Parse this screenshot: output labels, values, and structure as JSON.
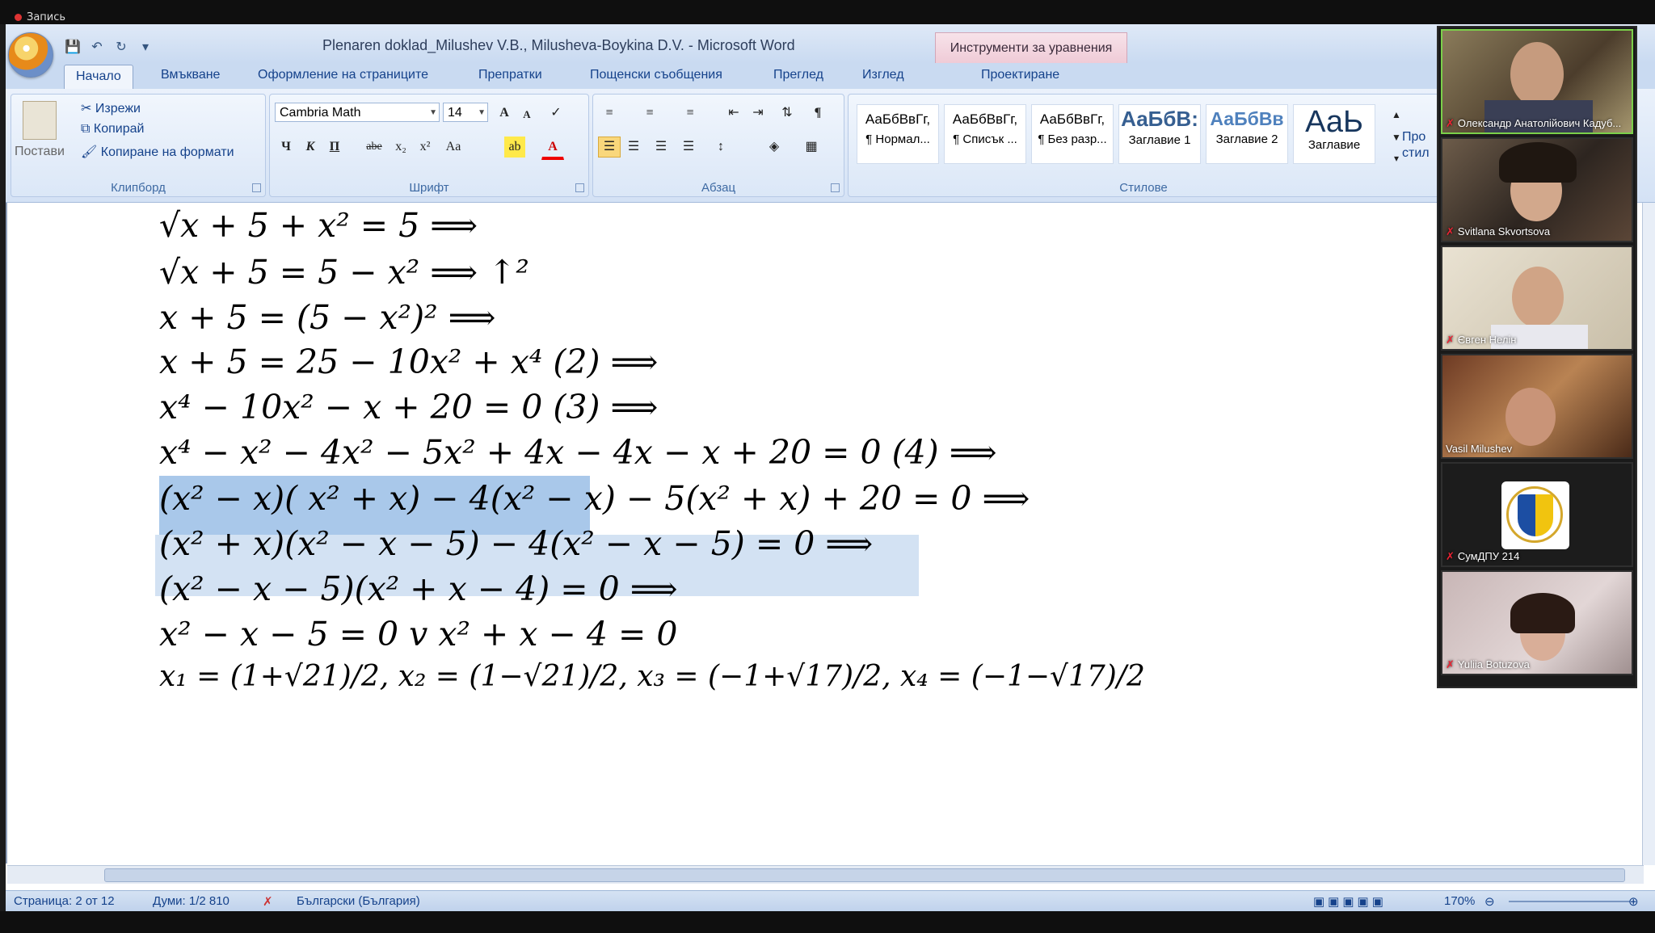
{
  "recording": {
    "label": "Запись"
  },
  "window": {
    "title": "Plenaren doklad_Milushev V.B., Milusheva-Boykina D.V. - Microsoft Word",
    "context_tool": "Инструменти за уравнения"
  },
  "tabs": [
    "Начало",
    "Вмъкване",
    "Оформление на страниците",
    "Препратки",
    "Пощенски съобщения",
    "Преглед",
    "Изглед",
    "Проектиране"
  ],
  "clipboard": {
    "paste": "Постави",
    "cut": "Изрежи",
    "copy": "Копирай",
    "format_painter": "Копиране на формати",
    "label": "Клипборд"
  },
  "font": {
    "name": "Cambria Math",
    "size": "14",
    "label": "Шрифт",
    "bold": "Ч",
    "italic": "К",
    "underline": "П",
    "strike": "abe",
    "sub": "x₂",
    "sup": "x²",
    "case": "Aa",
    "grow": "A",
    "shrink": "A"
  },
  "paragraph": {
    "label": "Абзац",
    "pilcrow": "¶"
  },
  "styles": {
    "label": "Стилове",
    "items": [
      {
        "sample": "АаБбВвГг,",
        "name": "¶ Нормал..."
      },
      {
        "sample": "АаБбВвГг,",
        "name": "¶ Списък ..."
      },
      {
        "sample": "АаБбВвГг,",
        "name": "¶ Без разр..."
      },
      {
        "sample": "АаБбВ:",
        "name": "Заглавие 1"
      },
      {
        "sample": "АаБбВв",
        "name": "Заглавие 2"
      },
      {
        "sample": "АаЬ",
        "name": "Заглавие"
      }
    ],
    "change": "Про\nстил"
  },
  "document": {
    "equations": [
      "√x + 5 + x² = 5  ⟹",
      "√x + 5 = 5 − x²  ⟹    ↑²",
      "x + 5 = (5 − x²)²  ⟹",
      "x + 5 = 25 − 10x² + x⁴   (2)  ⟹",
      "x⁴ − 10x² − x + 20 = 0   (3)  ⟹",
      "x⁴ − x² − 4x² − 5x² + 4x − 4x − x + 20 = 0     (4) ⟹",
      "(x² − x)( x² + x) − 4(x² − x) − 5(x² + x) + 20 = 0  ⟹",
      "(x² + x)(x² − x − 5) − 4(x² − x − 5) = 0  ⟹",
      "(x² − x − 5)(x² + x − 4) = 0  ⟹",
      "x² − x − 5 = 0   v   x² + x − 4 = 0",
      "x₁ = (1+√21)/2, x₂ = (1−√21)/2, x₃ = (−1+√17)/2, x₄ = (−1−√17)/2"
    ]
  },
  "statusbar": {
    "page": "Страница: 2 от 12",
    "words": "Думи: 1/2 810",
    "language": "Български (България)",
    "zoom": "170%"
  },
  "participants": [
    {
      "name": "Олександр Анатолійович Кадуб...",
      "active": true
    },
    {
      "name": "Svitlana Skvortsova",
      "active": false
    },
    {
      "name": "Євген Нелін",
      "active": false
    },
    {
      "name": "Vasil Milushev",
      "active": false
    },
    {
      "name": "СумДПУ 214",
      "active": false
    },
    {
      "name": "Yuliia Botuzova",
      "active": false
    }
  ]
}
